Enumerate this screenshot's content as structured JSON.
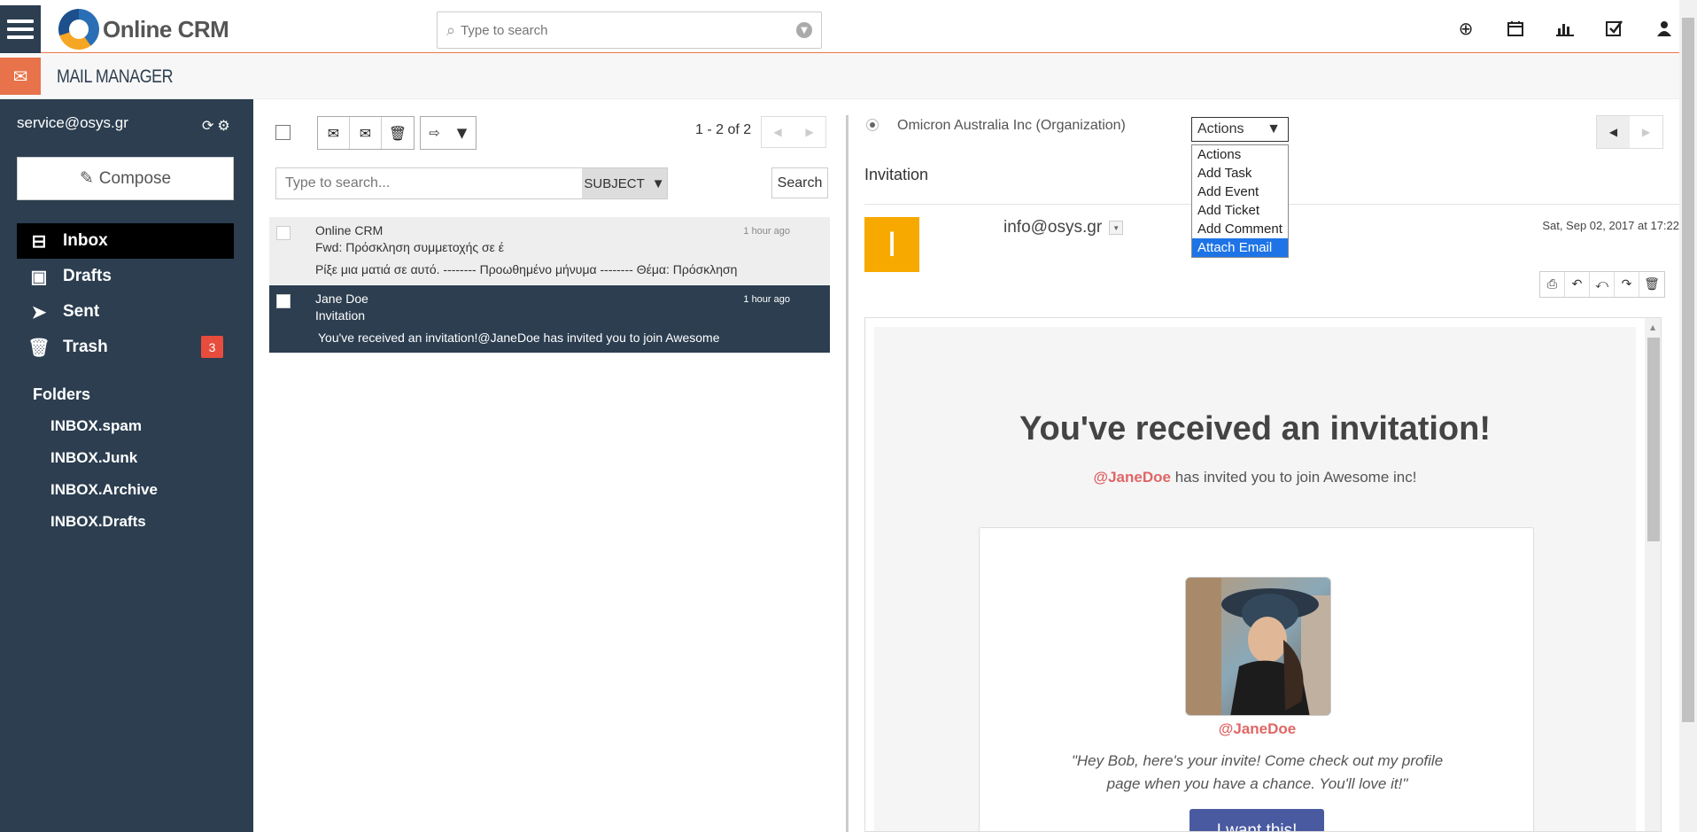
{
  "header": {
    "app_name": "Online CRM",
    "search_placeholder": "Type to search",
    "icons": [
      "plus-circle-icon",
      "calendar-icon",
      "bar-chart-icon",
      "checkbox-icon",
      "user-icon"
    ]
  },
  "module": {
    "title": "MAIL MANAGER"
  },
  "sidebar": {
    "account": "service@osys.gr",
    "compose_label": "Compose",
    "nav": [
      {
        "label": "Inbox",
        "icon": "inbox-icon",
        "active": true
      },
      {
        "label": "Drafts",
        "icon": "save-icon"
      },
      {
        "label": "Sent",
        "icon": "paper-plane-icon"
      },
      {
        "label": "Trash",
        "icon": "trash-icon",
        "count": "3"
      }
    ],
    "folders_title": "Folders",
    "folders": [
      "INBOX.spam",
      "INBOX.Junk",
      "INBOX.Archive",
      "INBOX.Drafts"
    ]
  },
  "list": {
    "pager": "1 - 2 of 2",
    "search_placeholder": "Type to search...",
    "search_field": "SUBJECT",
    "search_button": "Search",
    "messages": [
      {
        "from": "Online CRM",
        "time": "1 hour ago",
        "subject": "Fwd: Πρόσκληση συμμετοχής σε έ",
        "preview": "Ρίξε μια ματιά σε αυτό. -------- Προωθημένο μήνυμα -------- Θέμα: Πρόσκληση"
      },
      {
        "from": "Jane Doe",
        "time": "1 hour ago",
        "subject": "Invitation",
        "preview": "You've received an invitation!@JaneDoe has invited you to join Awesome",
        "selected": true
      }
    ]
  },
  "reader": {
    "related": "Omicron Australia Inc  (Organization)",
    "actions_selected": "Actions",
    "actions_options": [
      "Actions",
      "Add Task",
      "Add Event",
      "Add Ticket",
      "Add Comment",
      "Attach Email"
    ],
    "actions_highlighted": "Attach Email",
    "subject": "Invitation",
    "avatar_letter": "I",
    "sender": "info@osys.gr",
    "date": "Sat, Sep 02, 2017 at 17:22",
    "toolbar_icons": [
      "print-icon",
      "reply-icon",
      "reply-all-icon",
      "forward-icon",
      "delete-icon"
    ]
  },
  "email_body": {
    "headline": "You've received an invitation!",
    "handle": "@JaneDoe",
    "sub_text": " has invited you to join Awesome inc!",
    "card_handle": "@JaneDoe",
    "quote": "\"Hey Bob, here's your invite! Come check out my profile page when you have a chance. You'll love it!\"",
    "cta": "I want this!"
  },
  "colors": {
    "sidebar": "#2c3e50",
    "accent": "#e8734a",
    "highlight": "#1e74e6",
    "handle": "#e06666",
    "avatar": "#f8a900",
    "cta": "#4a5aa0"
  }
}
